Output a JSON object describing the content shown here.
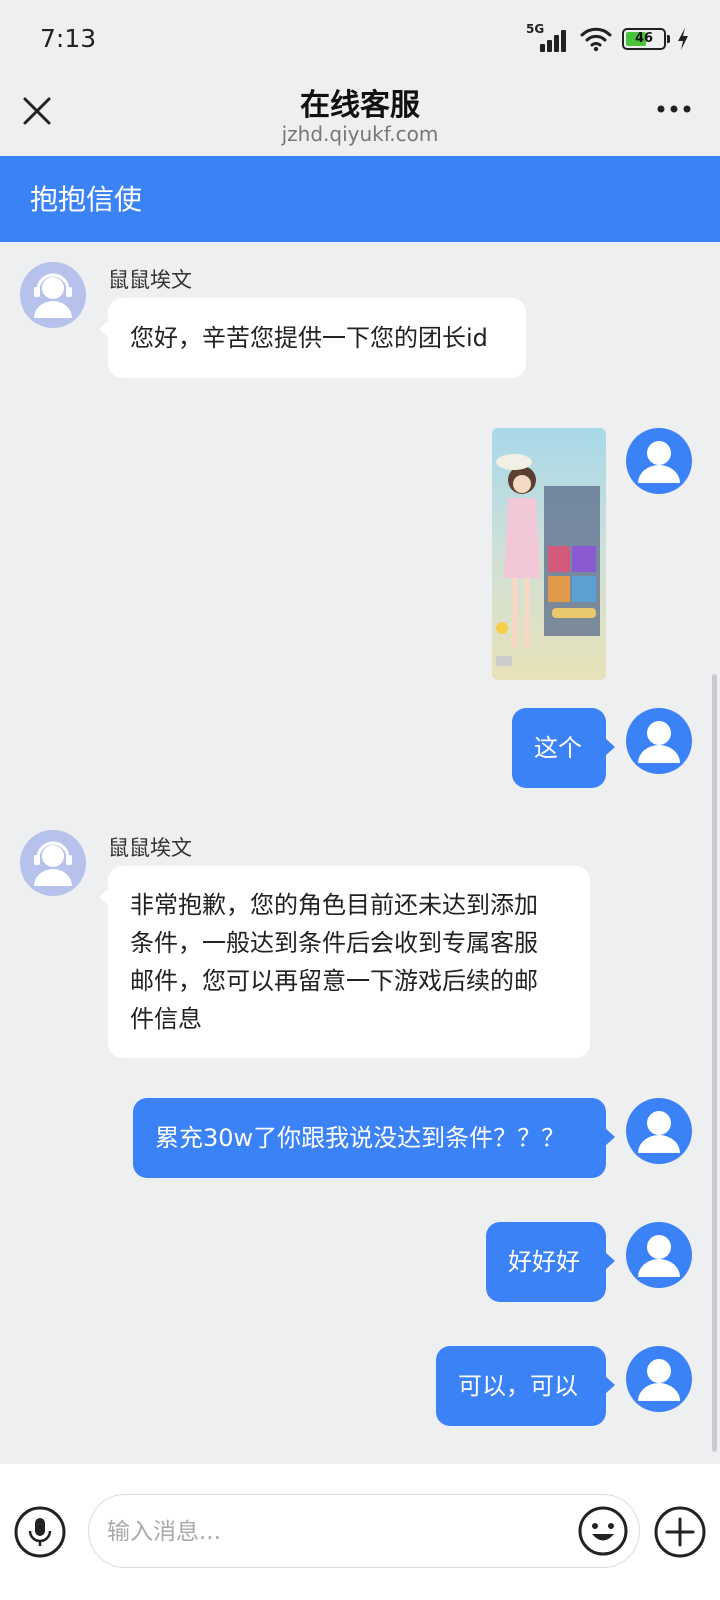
{
  "status": {
    "time": "7:13",
    "network": "5G",
    "battery": "46"
  },
  "header": {
    "title": "在线客服",
    "url": "jzhd.qiyukf.com"
  },
  "channel": {
    "name": "抱抱信使"
  },
  "messages": [
    {
      "from": "agent",
      "sender": "鼠鼠埃文",
      "text": "您好，辛苦您提供一下您的团长id"
    },
    {
      "from": "user",
      "type": "image"
    },
    {
      "from": "user",
      "text": "这个"
    },
    {
      "from": "agent",
      "sender": "鼠鼠埃文",
      "lines": [
        "非常抱歉，您的角色目前还未达到添加",
        "条件，一般达到条件后会收到专属客服",
        "邮件，您可以再留意一下游戏后续的邮",
        "件信息"
      ]
    },
    {
      "from": "user",
      "text": "累充30w了你跟我说没达到条件？？？"
    },
    {
      "from": "user",
      "text": "好好好"
    },
    {
      "from": "user",
      "text": "可以，可以"
    }
  ],
  "input": {
    "placeholder": "输入消息..."
  },
  "colors": {
    "accent": "#3b82f6",
    "background": "#eeeff1",
    "agent_avatar": "#b6c2ec"
  }
}
